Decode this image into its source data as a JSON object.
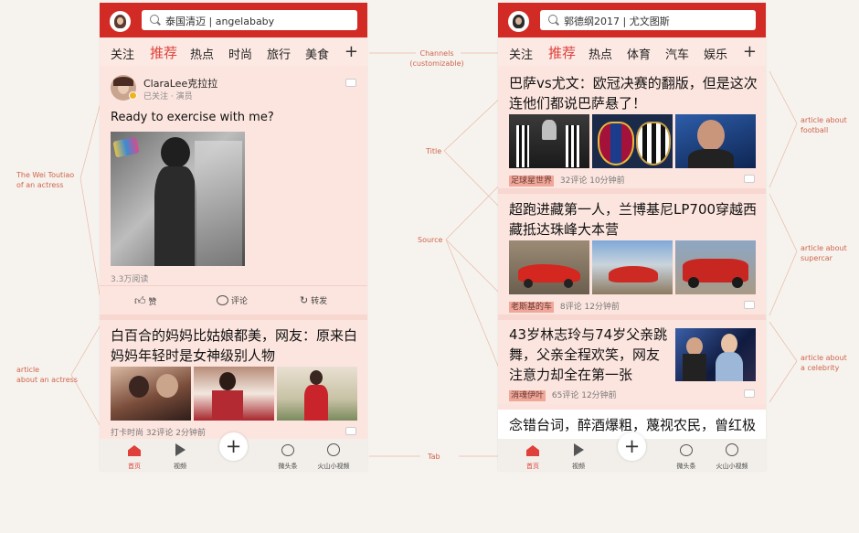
{
  "left_phone": {
    "search_text": "泰国清迈 | angelababy",
    "channels": [
      "关注",
      "推荐",
      "热点",
      "时尚",
      "旅行",
      "美食"
    ],
    "active_channel": "推荐",
    "post": {
      "author": "ClaraLee克拉拉",
      "author_meta": "已关注 · 演员",
      "text": "Ready to exercise with me?",
      "views": "3.3万阅读",
      "actions": [
        "赞",
        "评论",
        "转发"
      ]
    },
    "article": {
      "title": "白百合的妈妈比姑娘都美，网友：原来白妈妈年轻时是女神级别人物",
      "source": "打卡时尚",
      "comments": "32评论",
      "time": "2分钟前"
    },
    "tabs": [
      "首页",
      "视频",
      "",
      "微头条",
      "火山小视频"
    ]
  },
  "right_phone": {
    "search_text": "郭德纲2017 | 尤文图斯",
    "channels": [
      "关注",
      "推荐",
      "热点",
      "体育",
      "汽车",
      "娱乐"
    ],
    "active_channel": "推荐",
    "articles": [
      {
        "title": "巴萨vs尤文：欧冠决赛的翻版，但是这次连他们都说巴萨悬了！",
        "source": "足球星世界",
        "comments": "32评论",
        "time": "10分钟前"
      },
      {
        "title": "超跑进藏第一人，兰博基尼LP700穿越西藏抵达珠峰大本营",
        "source": "老斯基的车",
        "comments": "8评论",
        "time": "12分钟前"
      },
      {
        "title": "43岁林志玲与74岁父亲跳舞，父亲全程欢笑，网友注意力却全在第一张",
        "source": "消魂伊叶",
        "comments": "65评论",
        "time": "12分钟前"
      },
      {
        "title": "念错台词，醉酒爆粗，蔑视农民，曾红极"
      }
    ],
    "tabs": [
      "首页",
      "视频",
      "",
      "微头条",
      "火山小视频"
    ]
  },
  "annotations": {
    "channels": "Channels\n(customizable)",
    "title": "Title",
    "source": "Source",
    "tab": "Tab",
    "weitoutiao": "The Wei Toutiao\nof an actress",
    "article_actress": "article\nabout an actress",
    "article_football": "article about\nfootball",
    "article_supercar": "article about\nsupercar",
    "article_celebrity": "article about\na celebrity"
  },
  "colors": {
    "brand_red": "#d22b26",
    "accent": "#e0403a",
    "card_bg": "#fce5df",
    "annotation": "#d0644d"
  }
}
